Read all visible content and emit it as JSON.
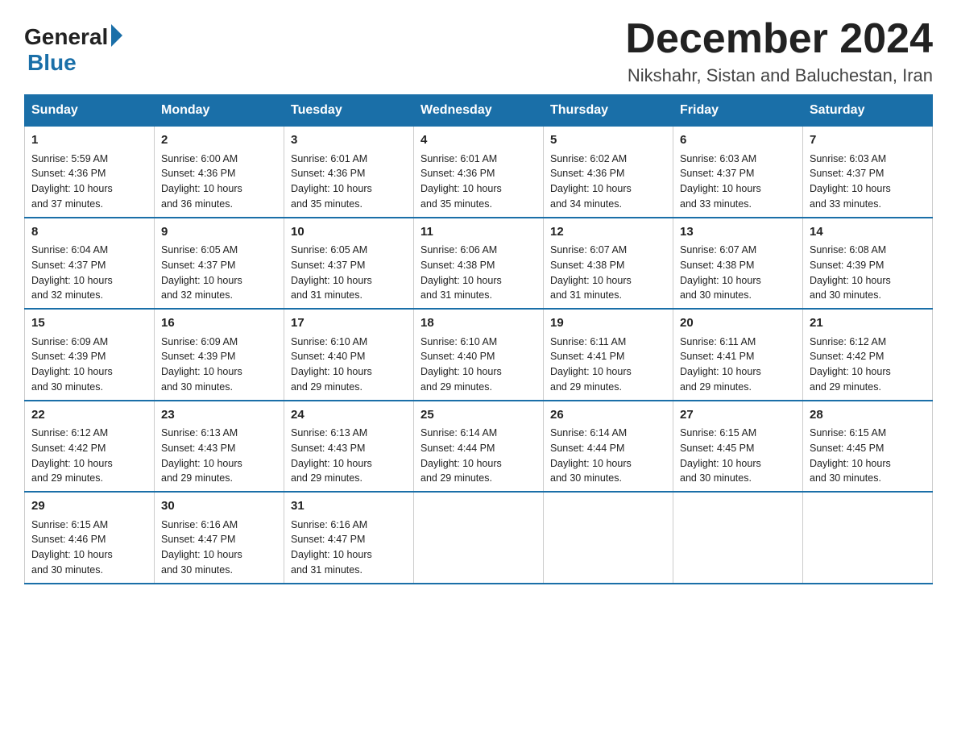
{
  "logo": {
    "general": "General",
    "blue": "Blue"
  },
  "title": "December 2024",
  "location": "Nikshahr, Sistan and Baluchestan, Iran",
  "days_of_week": [
    "Sunday",
    "Monday",
    "Tuesday",
    "Wednesday",
    "Thursday",
    "Friday",
    "Saturday"
  ],
  "weeks": [
    [
      {
        "day": "1",
        "sunrise": "5:59 AM",
        "sunset": "4:36 PM",
        "daylight": "10 hours and 37 minutes."
      },
      {
        "day": "2",
        "sunrise": "6:00 AM",
        "sunset": "4:36 PM",
        "daylight": "10 hours and 36 minutes."
      },
      {
        "day": "3",
        "sunrise": "6:01 AM",
        "sunset": "4:36 PM",
        "daylight": "10 hours and 35 minutes."
      },
      {
        "day": "4",
        "sunrise": "6:01 AM",
        "sunset": "4:36 PM",
        "daylight": "10 hours and 35 minutes."
      },
      {
        "day": "5",
        "sunrise": "6:02 AM",
        "sunset": "4:36 PM",
        "daylight": "10 hours and 34 minutes."
      },
      {
        "day": "6",
        "sunrise": "6:03 AM",
        "sunset": "4:37 PM",
        "daylight": "10 hours and 33 minutes."
      },
      {
        "day": "7",
        "sunrise": "6:03 AM",
        "sunset": "4:37 PM",
        "daylight": "10 hours and 33 minutes."
      }
    ],
    [
      {
        "day": "8",
        "sunrise": "6:04 AM",
        "sunset": "4:37 PM",
        "daylight": "10 hours and 32 minutes."
      },
      {
        "day": "9",
        "sunrise": "6:05 AM",
        "sunset": "4:37 PM",
        "daylight": "10 hours and 32 minutes."
      },
      {
        "day": "10",
        "sunrise": "6:05 AM",
        "sunset": "4:37 PM",
        "daylight": "10 hours and 31 minutes."
      },
      {
        "day": "11",
        "sunrise": "6:06 AM",
        "sunset": "4:38 PM",
        "daylight": "10 hours and 31 minutes."
      },
      {
        "day": "12",
        "sunrise": "6:07 AM",
        "sunset": "4:38 PM",
        "daylight": "10 hours and 31 minutes."
      },
      {
        "day": "13",
        "sunrise": "6:07 AM",
        "sunset": "4:38 PM",
        "daylight": "10 hours and 30 minutes."
      },
      {
        "day": "14",
        "sunrise": "6:08 AM",
        "sunset": "4:39 PM",
        "daylight": "10 hours and 30 minutes."
      }
    ],
    [
      {
        "day": "15",
        "sunrise": "6:09 AM",
        "sunset": "4:39 PM",
        "daylight": "10 hours and 30 minutes."
      },
      {
        "day": "16",
        "sunrise": "6:09 AM",
        "sunset": "4:39 PM",
        "daylight": "10 hours and 30 minutes."
      },
      {
        "day": "17",
        "sunrise": "6:10 AM",
        "sunset": "4:40 PM",
        "daylight": "10 hours and 29 minutes."
      },
      {
        "day": "18",
        "sunrise": "6:10 AM",
        "sunset": "4:40 PM",
        "daylight": "10 hours and 29 minutes."
      },
      {
        "day": "19",
        "sunrise": "6:11 AM",
        "sunset": "4:41 PM",
        "daylight": "10 hours and 29 minutes."
      },
      {
        "day": "20",
        "sunrise": "6:11 AM",
        "sunset": "4:41 PM",
        "daylight": "10 hours and 29 minutes."
      },
      {
        "day": "21",
        "sunrise": "6:12 AM",
        "sunset": "4:42 PM",
        "daylight": "10 hours and 29 minutes."
      }
    ],
    [
      {
        "day": "22",
        "sunrise": "6:12 AM",
        "sunset": "4:42 PM",
        "daylight": "10 hours and 29 minutes."
      },
      {
        "day": "23",
        "sunrise": "6:13 AM",
        "sunset": "4:43 PM",
        "daylight": "10 hours and 29 minutes."
      },
      {
        "day": "24",
        "sunrise": "6:13 AM",
        "sunset": "4:43 PM",
        "daylight": "10 hours and 29 minutes."
      },
      {
        "day": "25",
        "sunrise": "6:14 AM",
        "sunset": "4:44 PM",
        "daylight": "10 hours and 29 minutes."
      },
      {
        "day": "26",
        "sunrise": "6:14 AM",
        "sunset": "4:44 PM",
        "daylight": "10 hours and 30 minutes."
      },
      {
        "day": "27",
        "sunrise": "6:15 AM",
        "sunset": "4:45 PM",
        "daylight": "10 hours and 30 minutes."
      },
      {
        "day": "28",
        "sunrise": "6:15 AM",
        "sunset": "4:45 PM",
        "daylight": "10 hours and 30 minutes."
      }
    ],
    [
      {
        "day": "29",
        "sunrise": "6:15 AM",
        "sunset": "4:46 PM",
        "daylight": "10 hours and 30 minutes."
      },
      {
        "day": "30",
        "sunrise": "6:16 AM",
        "sunset": "4:47 PM",
        "daylight": "10 hours and 30 minutes."
      },
      {
        "day": "31",
        "sunrise": "6:16 AM",
        "sunset": "4:47 PM",
        "daylight": "10 hours and 31 minutes."
      },
      null,
      null,
      null,
      null
    ]
  ],
  "labels": {
    "sunrise": "Sunrise:",
    "sunset": "Sunset:",
    "daylight": "Daylight:"
  }
}
